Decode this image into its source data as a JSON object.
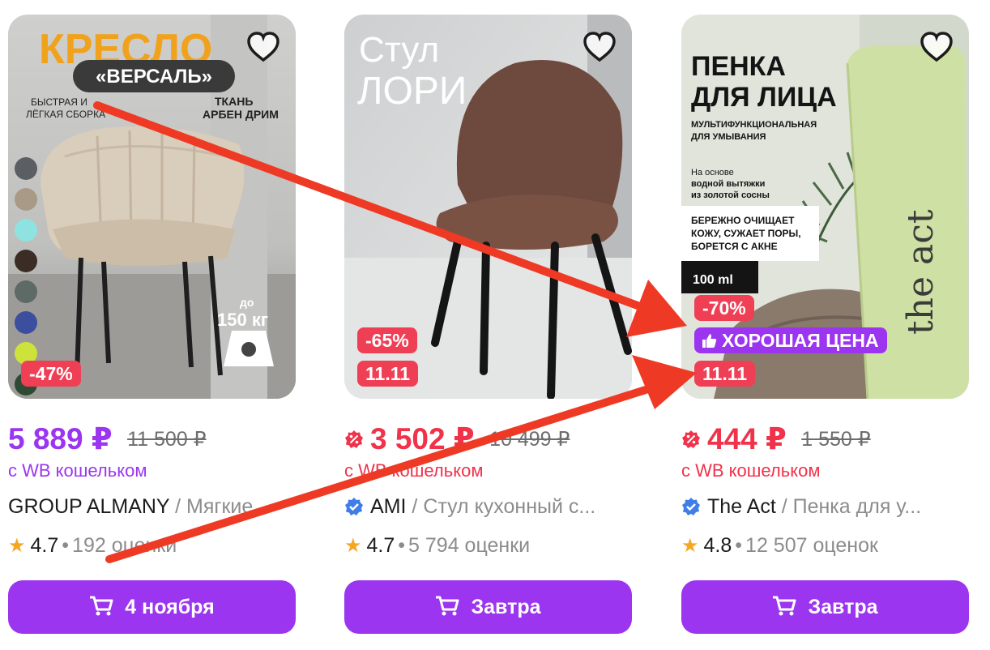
{
  "products": [
    {
      "image_text": {
        "headline": "КРЕСЛО",
        "model": "«ВЕРСАЛЬ»",
        "feature_left": [
          "БЫСТРАЯ И",
          "ЛЁГКАЯ СБОРКА"
        ],
        "feature_right": [
          "ТКАНЬ",
          "АРБЕН ДРИМ"
        ],
        "weight_prefix": "до",
        "weight": "150 кг"
      },
      "discount_badge": "-47%",
      "price": "5 889 ₽",
      "old_price": "11 500 ₽",
      "wallet_label": "с WB кошельком",
      "brand": "GROUP ALMANY",
      "separator": "/",
      "product_name": "Мягкие",
      "rating": "4.7",
      "reviews": "192 оценки",
      "delivery": "4 ноября",
      "swatch_colors": [
        "#5b5f63",
        "#a89a86",
        "#8ee3e0",
        "#3b2d26",
        "#5e6a66",
        "#3b4f9e",
        "#cde23a",
        "#2f4a34"
      ]
    },
    {
      "image_text": {
        "line1": "Стул",
        "line2": "ЛОРИ"
      },
      "discount_badge": "-65%",
      "sale_badge": "11.11",
      "price": "3 502 ₽",
      "old_price": "10 499 ₽",
      "wallet_label": "с WB кошельком",
      "brand": "AMI",
      "separator": "/",
      "product_name": "Стул кухонный с...",
      "rating": "4.7",
      "reviews": "5 794 оценки",
      "delivery": "Завтра"
    },
    {
      "image_text": {
        "headline1": "ПЕНКА",
        "headline2": "ДЛЯ ЛИЦА",
        "sub1": "МУЛЬТИФУНКЦИОНАЛЬНАЯ",
        "sub2": "ДЛЯ УМЫВАНИЯ",
        "basis1": "На основе",
        "basis2": "водной вытяжки",
        "basis3": "из золотой сосны",
        "claim1": "БЕРЕЖНО ОЧИЩАЕТ",
        "claim2": "КОЖУ, СУЖАЕТ ПОРЫ,",
        "claim3": "БОРЕТСЯ С АКНЕ",
        "volume": "100 ml",
        "tube_brand": "the act"
      },
      "discount_badge": "-70%",
      "good_price_badge": "ХОРОШАЯ ЦЕНА",
      "sale_badge": "11.11",
      "price": "444 ₽",
      "old_price": "1 550 ₽",
      "wallet_label": "с WB кошельком",
      "brand": "The Act",
      "separator": "/",
      "product_name": "Пенка для у...",
      "rating": "4.8",
      "reviews": "12 507 оценок",
      "delivery": "Завтра"
    }
  ],
  "icons": {
    "favorite": "heart-outline-icon",
    "cart": "cart-icon",
    "star": "star-icon",
    "sale": "discount-icon",
    "verified": "verified-check-icon",
    "thumbs_up": "thumbs-up-icon",
    "scale": "scale-icon"
  },
  "colors": {
    "accent_purple": "#9b35f0",
    "discount_red": "#f0324a",
    "badge_red": "#ef3f55",
    "annotation_arrow": "#ee3a24"
  }
}
